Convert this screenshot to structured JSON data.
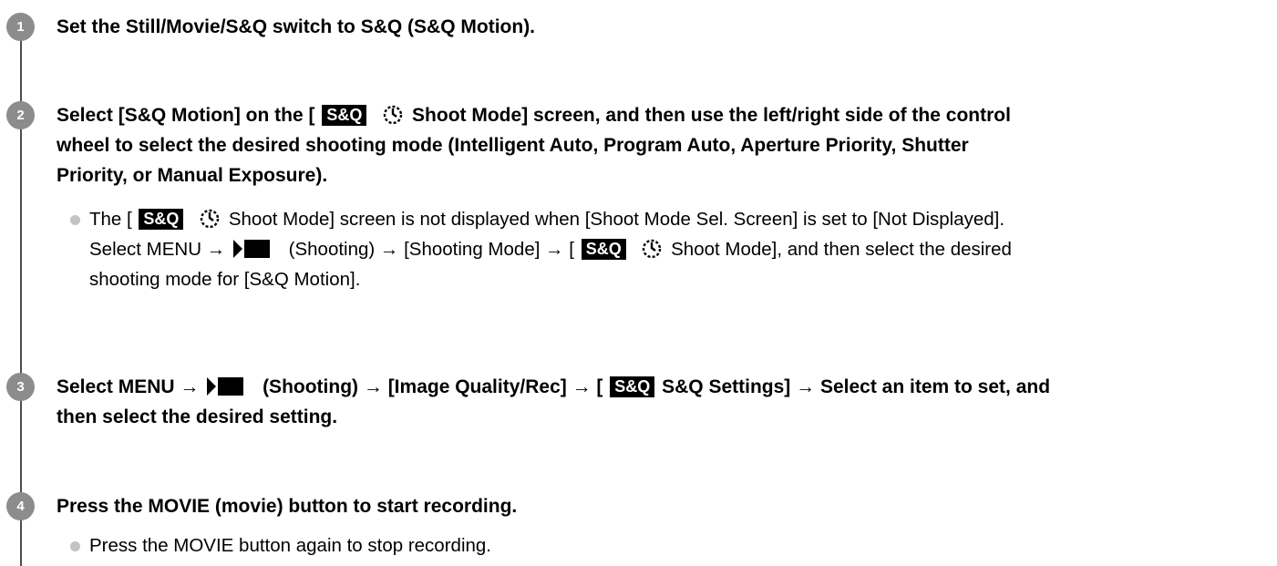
{
  "icons": {
    "sq_badge": "S&Q",
    "dial": "shooting-mode-dial-icon",
    "shoot": "shooting-menu-icon"
  },
  "steps": [
    {
      "number": "1",
      "text": "Set the Still/Movie/S&Q switch to S&Q (S&Q Motion)."
    },
    {
      "number": "2",
      "line1_a": "Select [S&Q Motion] on the [",
      "line1_b": "Shoot Mode] screen, and then use the left/right side of the control",
      "line2": "wheel to select the desired shooting mode (Intelligent Auto, Program Auto, Aperture Priority, Shutter",
      "line3": "Priority, or Manual Exposure).",
      "note": {
        "line1_a": "The [",
        "line1_b": "Shoot Mode] screen is not displayed when [Shoot Mode Sel. Screen] is set to [Not Displayed].",
        "line2_a": "Select MENU →",
        "line2_b": "(Shooting) → [Shooting Mode] → [",
        "line2_c": "Shoot Mode], and then select the desired",
        "line3": "shooting mode for [S&Q Motion]."
      }
    },
    {
      "number": "3",
      "line1_a": "Select MENU →",
      "line1_b": "(Shooting) → [Image Quality/Rec] → [",
      "line1_c": "S&Q Settings] → Select an item to set, and",
      "line2": "then select the desired setting."
    },
    {
      "number": "4",
      "text": "Press the MOVIE (movie) button to start recording.",
      "note": "Press the MOVIE button again to stop recording."
    }
  ]
}
